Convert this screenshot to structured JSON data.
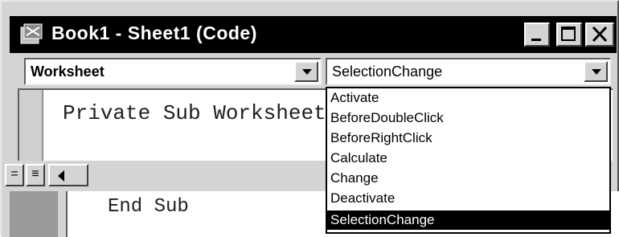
{
  "window": {
    "title": "Book1 - Sheet1 (Code)",
    "title_icon": "excel-code-icon"
  },
  "title_buttons": {
    "minimize": "minimize-icon",
    "maximize": "maximize-icon",
    "close": "close-icon"
  },
  "object_combo": {
    "value": "Worksheet"
  },
  "procedure_combo": {
    "value": "SelectionChange"
  },
  "code": {
    "first_line": "Private Sub Worksheet",
    "last_line": "End Sub"
  },
  "dropdown": {
    "items": [
      "Activate",
      "BeforeDoubleClick",
      "BeforeRightClick",
      "Calculate",
      "Change",
      "Deactivate",
      "SelectionChange"
    ],
    "selected": "SelectionChange"
  },
  "colors": {
    "selection_bg": "#000000",
    "selection_fg": "#ffffff",
    "window_bg": "#d4d4d4"
  }
}
